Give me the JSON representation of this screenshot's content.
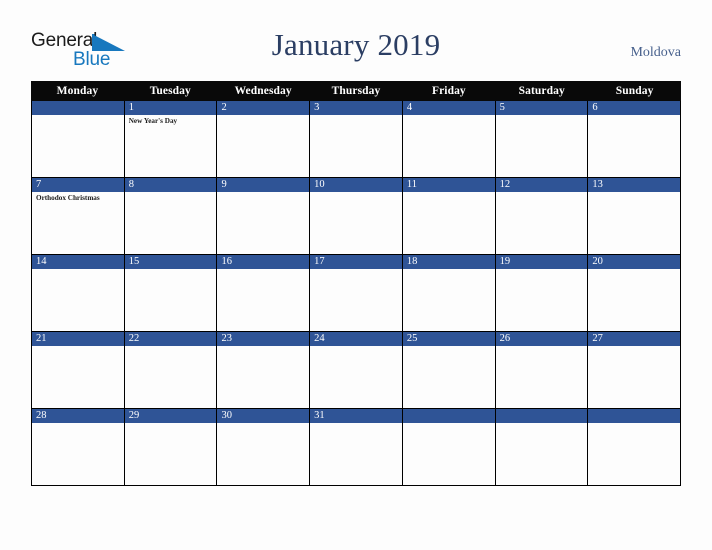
{
  "brand": {
    "line1": "General",
    "line2": "Blue",
    "triangle_color": "#1878be",
    "line1_color": "#1b1b1b",
    "line2_color": "#1878be"
  },
  "header": {
    "title": "January 2019",
    "country": "Moldova",
    "title_color": "#2b3e63",
    "country_color": "#47608c"
  },
  "calendar": {
    "weekday_header_bg": "#090909",
    "date_band_color": "#2f5496",
    "grid_line_color": "#000000",
    "weekdays": [
      "Monday",
      "Tuesday",
      "Wednesday",
      "Thursday",
      "Friday",
      "Saturday",
      "Sunday"
    ],
    "weeks": [
      [
        {
          "day": "",
          "events": []
        },
        {
          "day": "1",
          "events": [
            "New Year's Day"
          ]
        },
        {
          "day": "2",
          "events": []
        },
        {
          "day": "3",
          "events": []
        },
        {
          "day": "4",
          "events": []
        },
        {
          "day": "5",
          "events": []
        },
        {
          "day": "6",
          "events": []
        }
      ],
      [
        {
          "day": "7",
          "events": [
            "Orthodox Christmas"
          ]
        },
        {
          "day": "8",
          "events": []
        },
        {
          "day": "9",
          "events": []
        },
        {
          "day": "10",
          "events": []
        },
        {
          "day": "11",
          "events": []
        },
        {
          "day": "12",
          "events": []
        },
        {
          "day": "13",
          "events": []
        }
      ],
      [
        {
          "day": "14",
          "events": []
        },
        {
          "day": "15",
          "events": []
        },
        {
          "day": "16",
          "events": []
        },
        {
          "day": "17",
          "events": []
        },
        {
          "day": "18",
          "events": []
        },
        {
          "day": "19",
          "events": []
        },
        {
          "day": "20",
          "events": []
        }
      ],
      [
        {
          "day": "21",
          "events": []
        },
        {
          "day": "22",
          "events": []
        },
        {
          "day": "23",
          "events": []
        },
        {
          "day": "24",
          "events": []
        },
        {
          "day": "25",
          "events": []
        },
        {
          "day": "26",
          "events": []
        },
        {
          "day": "27",
          "events": []
        }
      ],
      [
        {
          "day": "28",
          "events": []
        },
        {
          "day": "29",
          "events": []
        },
        {
          "day": "30",
          "events": []
        },
        {
          "day": "31",
          "events": []
        },
        {
          "day": "",
          "events": []
        },
        {
          "day": "",
          "events": []
        },
        {
          "day": "",
          "events": []
        }
      ]
    ]
  }
}
